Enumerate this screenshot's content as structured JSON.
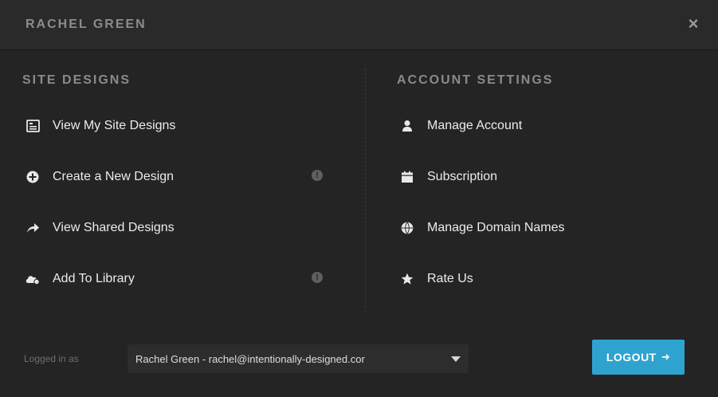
{
  "header": {
    "title": "RACHEL GREEN",
    "close_label": "×"
  },
  "site_designs": {
    "title": "SITE DESIGNS",
    "items": [
      {
        "label": "View My Site Designs",
        "icon": "designs-list-icon"
      },
      {
        "label": "Create a New Design",
        "icon": "plus-circle-icon",
        "info": "!"
      },
      {
        "label": "View Shared Designs",
        "icon": "share-arrow-icon"
      },
      {
        "label": "Add To Library",
        "icon": "library-cloud-icon",
        "info": "!"
      }
    ]
  },
  "account_settings": {
    "title": "ACCOUNT SETTINGS",
    "items": [
      {
        "label": "Manage Account",
        "icon": "user-icon"
      },
      {
        "label": "Subscription",
        "icon": "calendar-icon"
      },
      {
        "label": "Manage Domain Names",
        "icon": "globe-icon"
      },
      {
        "label": "Rate Us",
        "icon": "star-icon"
      }
    ]
  },
  "footer": {
    "logged_in_label": "Logged in as",
    "account_value": "Rachel Green - rachel@intentionally-designed.cor",
    "logout_label": "LOGOUT",
    "logout_arrow": "➜"
  },
  "colors": {
    "accent": "#2ea3cf",
    "background": "#242424"
  }
}
